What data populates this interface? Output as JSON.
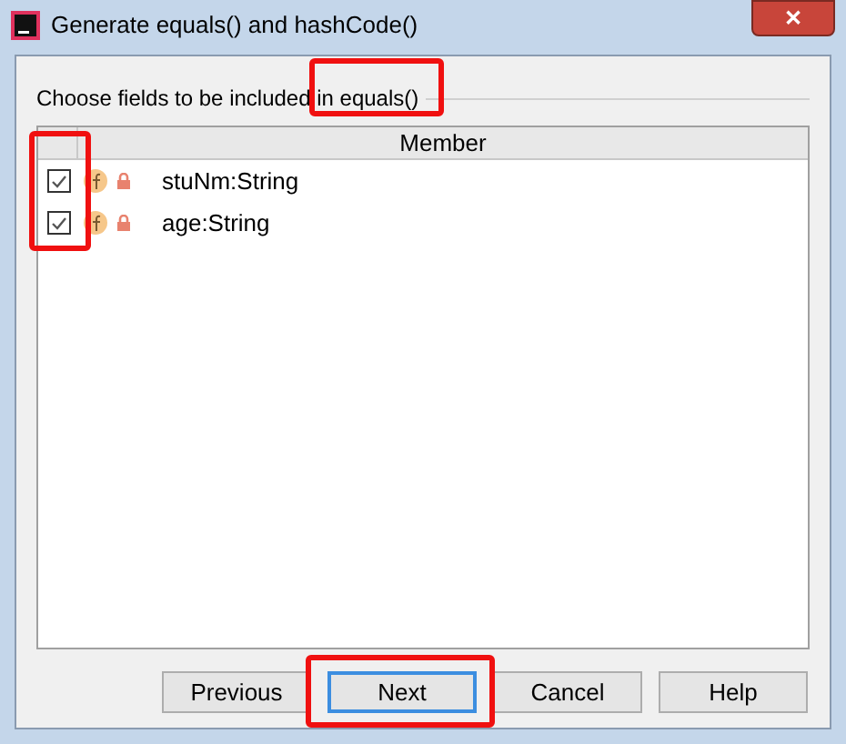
{
  "window": {
    "title": "Generate equals() and hashCode()",
    "close": "✕"
  },
  "section": {
    "title": "Choose fields to be included in equals()"
  },
  "table": {
    "columns": [
      "Member"
    ],
    "rows": [
      {
        "name": "stuNm:String",
        "checked": true
      },
      {
        "name": "age:String",
        "checked": true
      }
    ]
  },
  "buttons": [
    {
      "label": "Previous",
      "selected": false
    },
    {
      "label": "Next",
      "selected": true
    },
    {
      "label": "Cancel",
      "selected": false
    },
    {
      "label": "Help",
      "selected": false
    }
  ]
}
